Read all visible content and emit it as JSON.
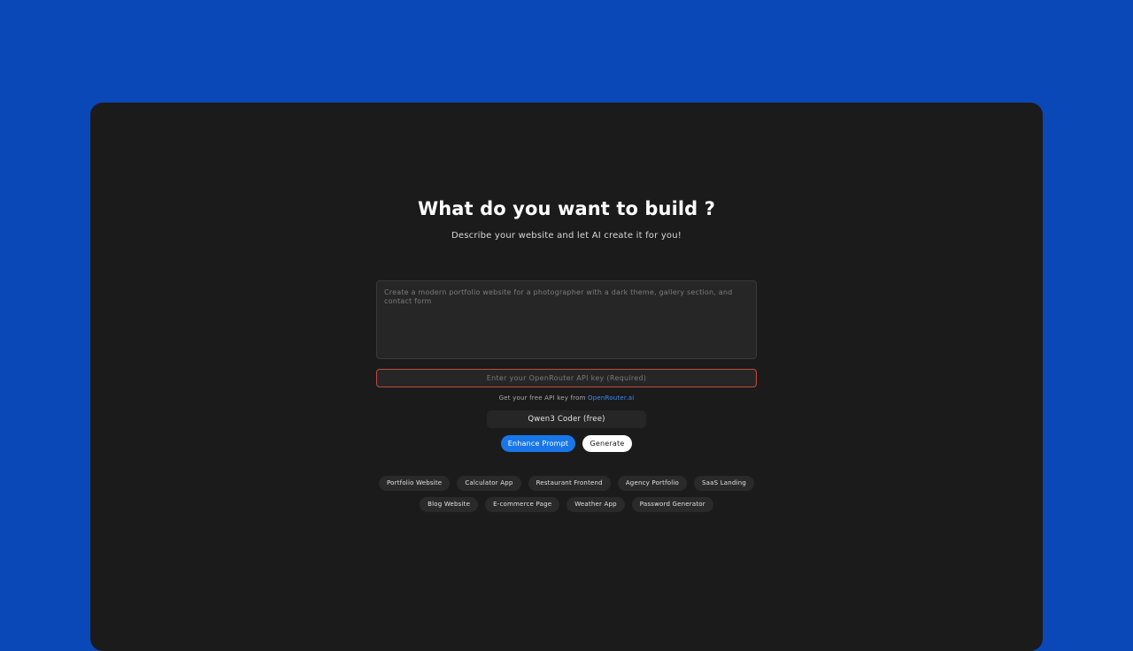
{
  "header": {
    "title": "What do you want to build ?",
    "subtitle": "Describe your website and let AI create it for you!"
  },
  "prompt": {
    "value": "",
    "placeholder": "Create a modern portfolio website for a photographer with a dark theme, gallery section, and contact form"
  },
  "api_key": {
    "value": "",
    "placeholder": "Enter your OpenRouter API key (Required)"
  },
  "hint": {
    "text": "Get your free API key from",
    "link_label": "OpenRouter.ai"
  },
  "model": {
    "selected": "Qwen3 Coder (free)"
  },
  "actions": {
    "enhance_label": "Enhance Prompt",
    "generate_label": "Generate"
  },
  "templates": {
    "row1": [
      "Portfolio Website",
      "Calculator App",
      "Restaurant Frontend",
      "Agency Portfolio",
      "SaaS Landing"
    ],
    "row2": [
      "Blog Website",
      "E-commerce Page",
      "Weather App",
      "Password Generator"
    ]
  },
  "colors": {
    "background": "#0a48b8",
    "card": "#1b1b1b",
    "accent": "#1877e8",
    "error_border": "#c24a3e",
    "link": "#3e8cf0"
  }
}
